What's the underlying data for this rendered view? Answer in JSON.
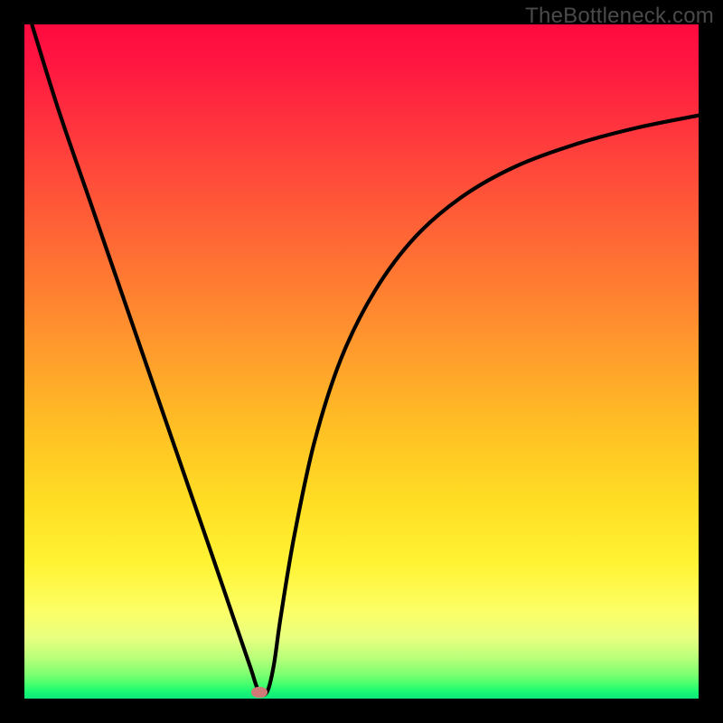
{
  "watermark": "TheBottleneck.com",
  "chart_data": {
    "type": "line",
    "title": "",
    "xlabel": "",
    "ylabel": "",
    "xlim": [
      0,
      100
    ],
    "ylim": [
      0,
      100
    ],
    "gradient_stops": [
      {
        "pct": 0,
        "color": "#ff0a3f"
      },
      {
        "pct": 33,
        "color": "#ff6b34"
      },
      {
        "pct": 71,
        "color": "#ffde24"
      },
      {
        "pct": 87,
        "color": "#fcff66"
      },
      {
        "pct": 100,
        "color": "#0de87a"
      }
    ],
    "series": [
      {
        "name": "bottleneck-curve",
        "x": [
          0.5,
          5,
          10,
          15,
          20,
          25,
          28,
          31,
          33.5,
          34.8,
          36,
          37,
          38,
          40,
          43,
          47,
          52,
          58,
          65,
          73,
          82,
          91,
          100
        ],
        "y": [
          102,
          87.5,
          73,
          58.5,
          44,
          29.5,
          20.8,
          12,
          4.7,
          1.0,
          1.0,
          5,
          12,
          24,
          38,
          50.5,
          60.5,
          68.5,
          74.5,
          79,
          82.3,
          84.7,
          86.5
        ]
      }
    ],
    "marker": {
      "x": 34.9,
      "y": 1.0,
      "color": "#cf7a76"
    }
  }
}
